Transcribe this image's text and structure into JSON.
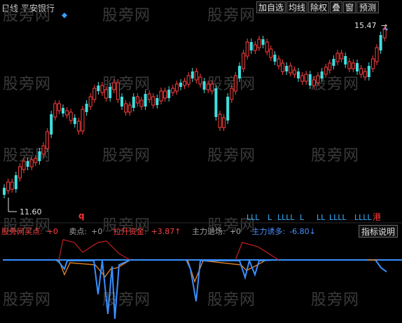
{
  "title": "日线 平安银行",
  "toolbar": {
    "buttons": [
      "加自选",
      "均线",
      "除权",
      "叠",
      "窗",
      "预测"
    ]
  },
  "watermark": "股旁网",
  "price": {
    "high_label": "15.47",
    "low_label": "11.60"
  },
  "markers": {
    "q_label": "q",
    "l_labels": [
      "LLL",
      "L",
      "LLLL",
      "L",
      "LL",
      "LLLL",
      "LLLL"
    ],
    "hk_label": "港"
  },
  "indicator": {
    "legend": [
      {
        "label": "股旁网买点:",
        "value": "+0",
        "color": "#ff4040"
      },
      {
        "label": "卖点:",
        "value": "+0",
        "color": "#a0a0a0"
      },
      {
        "label": "拉升资金:",
        "value": "+3.87↑",
        "color": "#ff4040"
      },
      {
        "label": "主力退场:",
        "value": "+0",
        "color": "#a0a0a0"
      },
      {
        "label": "主力诱多:",
        "value": "-6.80↓",
        "color": "#4a90ff"
      }
    ],
    "help_button": "指标说明"
  },
  "colors": {
    "up": "#ff4040",
    "down": "#40e0e0",
    "blue": "#3a8fff",
    "orange": "#e08020",
    "red": "#c02020",
    "diamond": "#3aa0ff"
  },
  "chart_data": {
    "type": "candlestick",
    "low_label": 11.6,
    "high_label": 15.47
  }
}
